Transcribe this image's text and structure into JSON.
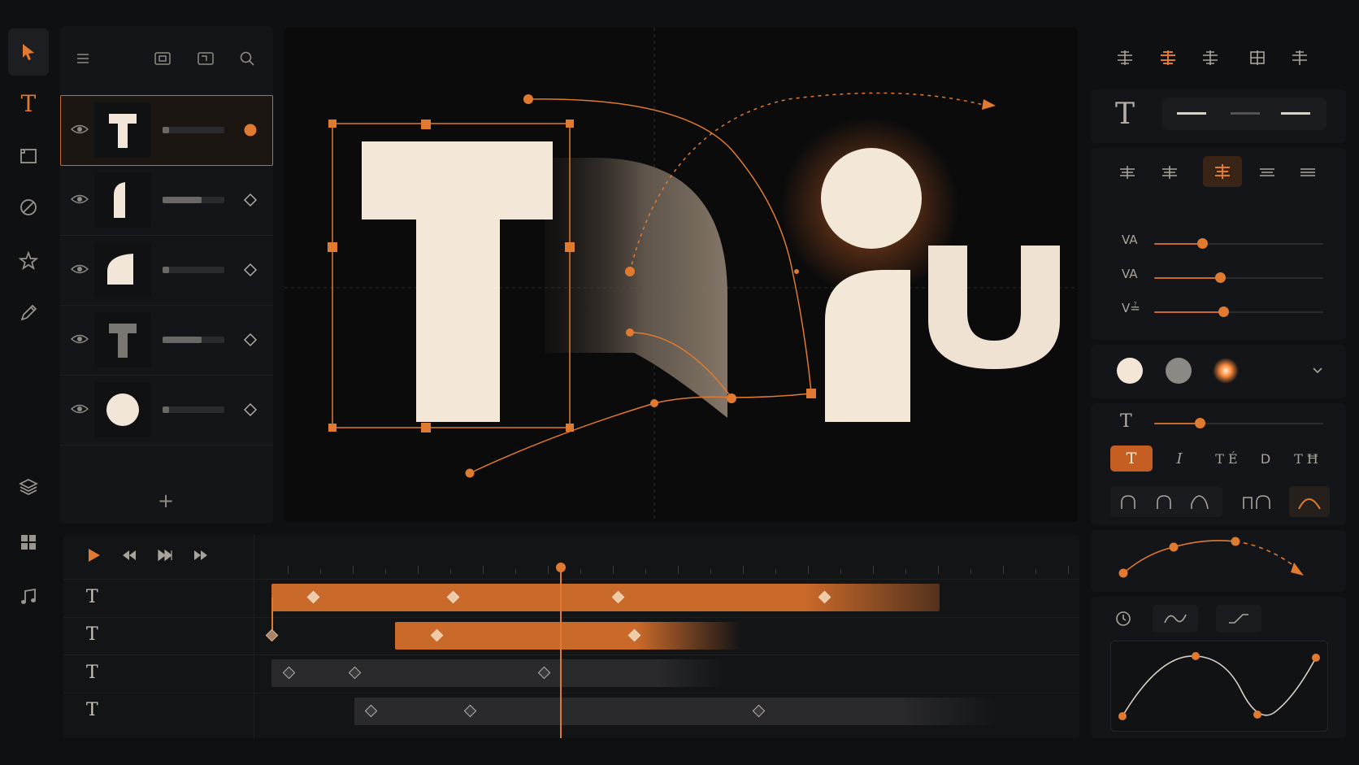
{
  "toolbar": {
    "tools": [
      {
        "icon": "select-arrow-icon",
        "active": true
      },
      {
        "icon": "text-tool-icon",
        "glyph": "T"
      },
      {
        "icon": "rectangle-tool-icon"
      },
      {
        "icon": "ellipse-slash-tool-icon"
      },
      {
        "icon": "star-tool-icon"
      },
      {
        "icon": "pen-tool-icon"
      }
    ],
    "bottom_tools": [
      {
        "icon": "layers-icon"
      },
      {
        "icon": "grid-icon"
      },
      {
        "icon": "music-note-icon"
      }
    ]
  },
  "layers_panel": {
    "header_icons": [
      "menu-icon",
      "group-icon",
      "ungroup-icon",
      "search-icon"
    ],
    "add_label": "+",
    "layers": [
      {
        "name": "layer-t",
        "selected": true,
        "keyframe": "filled-dot",
        "progress": 0.1
      },
      {
        "name": "layer-half-arch",
        "keyframe": "diamond",
        "progress": 0.6
      },
      {
        "name": "layer-quarter",
        "keyframe": "diamond",
        "progress": 0.1
      },
      {
        "name": "layer-t-gray",
        "keyframe": "diamond",
        "progress": 0.6
      },
      {
        "name": "layer-circle",
        "keyframe": "diamond",
        "progress": 0.1
      }
    ]
  },
  "canvas": {
    "letters": [
      "T",
      "i",
      "u"
    ]
  },
  "inspector": {
    "text_glyph": "T",
    "sliders": [
      {
        "label": "VA",
        "value": 0.29
      },
      {
        "label": "VA",
        "value": 0.39
      },
      {
        "label": "V≟",
        "value": 0.41
      }
    ],
    "size_label": "T",
    "size_value": 0.3,
    "style_buttons": [
      "T",
      "I",
      "T É",
      "D",
      "T Ħ"
    ],
    "colors": {
      "accent": "#e07a30",
      "swatch_1": "#f3e6d6",
      "swatch_2": "#8c8984",
      "swatch_3": "#ff8a3a"
    },
    "chevron_icon": "chevron-down-icon",
    "easing_icons": [
      "clock-icon",
      "wave-icon",
      "ramp-icon"
    ]
  },
  "timeline": {
    "transport": [
      "play-icon",
      "rewind-icon",
      "step-icon",
      "fast-forward-icon"
    ],
    "playhead": 0.37,
    "tracks": [
      {
        "label": "T",
        "clip_start": 0.02,
        "clip_end": 0.83,
        "style": "orange",
        "keyframes": [
          0.07,
          0.24,
          0.44,
          0.69
        ]
      },
      {
        "label": "T",
        "clip_start": 0.17,
        "clip_end": 0.59,
        "style": "orange-fade",
        "keyframes": [
          0.22,
          0.46
        ]
      },
      {
        "label": "T",
        "clip_start": 0.02,
        "clip_end": 0.57,
        "style": "gray",
        "keyframes": [
          0.04,
          0.12,
          0.35
        ]
      },
      {
        "label": "T",
        "clip_start": 0.12,
        "clip_end": 0.9,
        "style": "gray",
        "keyframes": [
          0.14,
          0.26,
          0.61
        ]
      }
    ]
  }
}
